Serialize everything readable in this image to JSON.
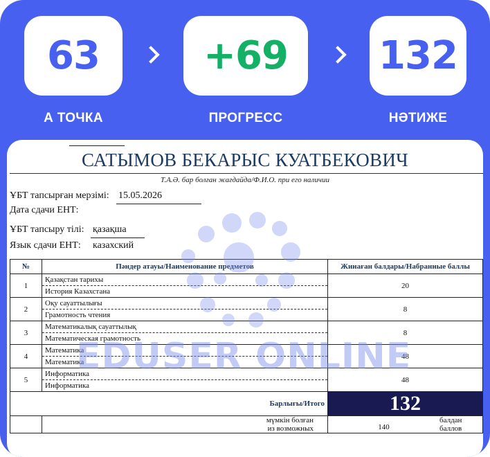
{
  "stats": {
    "start": {
      "value": "63",
      "label": "А ТОЧКА"
    },
    "progress": {
      "value": "+69",
      "label": "ПРОГРЕСС"
    },
    "result": {
      "value": "132",
      "label": "НӘТИЖЕ"
    }
  },
  "certificate": {
    "name": "САТЫМОВ БЕКАРЫС КУАТБЕКОВИЧ",
    "fio_caption": "Т.А.Ә. бар болған жағдайда/Ф.И.О. при его наличии",
    "date_label_kz": "ҰБТ тапсырған мерзімі:",
    "date_value": "15.05.2026",
    "date_label_ru": "Дата сдачи ЕНТ:",
    "lang_label_kz": "ҰБТ тапсыру тілі:",
    "lang_value_kz": "қазақша",
    "lang_label_ru": "Язык сдачи ЕНТ:",
    "lang_value_ru": "казахский",
    "table": {
      "headers": {
        "no": "№",
        "subject": "Пәндер атауы/Наименование предметов",
        "score": "Жинаған балдары/Набранные баллы"
      },
      "rows": [
        {
          "no": "1",
          "kz": "Қазақстан тарихы",
          "ru": "История Казахстана",
          "score": "20"
        },
        {
          "no": "2",
          "kz": "Оқу сауаттылығы",
          "ru": "Грамотность чтения",
          "score": "8"
        },
        {
          "no": "3",
          "kz": "Математикалық сауаттылық",
          "ru": "Математическая грамотность",
          "score": "8"
        },
        {
          "no": "4",
          "kz": "Математика",
          "ru": "Математика",
          "score": "48"
        },
        {
          "no": "5",
          "kz": "Информатика",
          "ru": "Информатика",
          "score": "48"
        }
      ],
      "total_label": "Барлығы/Итого",
      "total_value": "132",
      "max_label_kz": "мүмкін болған",
      "max_label_ru": "из возможных",
      "max_value": "140",
      "max_unit_kz": "балдан",
      "max_unit_ru": "баллов"
    }
  },
  "watermark": {
    "text": "EDUSER ONLINE",
    "icon": "eduser-logo-icon"
  },
  "colors": {
    "frame": "#4760ef",
    "progress": "#13b066",
    "total_bg": "#1a1a52",
    "heading": "#1c3b63"
  }
}
